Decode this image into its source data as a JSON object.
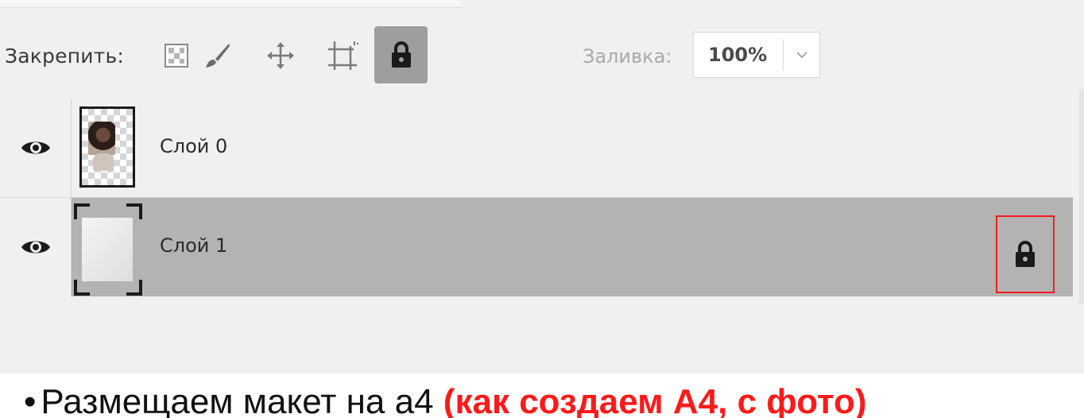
{
  "lock_bar": {
    "label": "Закрепить:",
    "tools": [
      {
        "name": "lock-transparent-pixels",
        "icon": "checker-icon"
      },
      {
        "name": "lock-image-pixels",
        "icon": "brush-icon"
      },
      {
        "name": "lock-position",
        "icon": "move-icon"
      },
      {
        "name": "lock-artboard",
        "icon": "artboard-icon"
      },
      {
        "name": "lock-all",
        "icon": "lock-icon",
        "active": true
      }
    ]
  },
  "fill": {
    "label": "Заливка:",
    "value": "100%"
  },
  "layers": [
    {
      "name": "Слой 0",
      "visible": true,
      "selected": false,
      "locked": false,
      "thumb": "photo"
    },
    {
      "name": "Слой 1",
      "visible": true,
      "selected": true,
      "locked": true,
      "thumb": "artboard"
    }
  ],
  "caption": {
    "bullet": "•",
    "text": "Размещаем макет на а4 ",
    "highlight": "(как создаем А4, с фото)"
  },
  "colors": {
    "panel_bg": "#f0f0f0",
    "selected_row": "#b3b3b3",
    "highlight_red": "#ff1a1a"
  }
}
